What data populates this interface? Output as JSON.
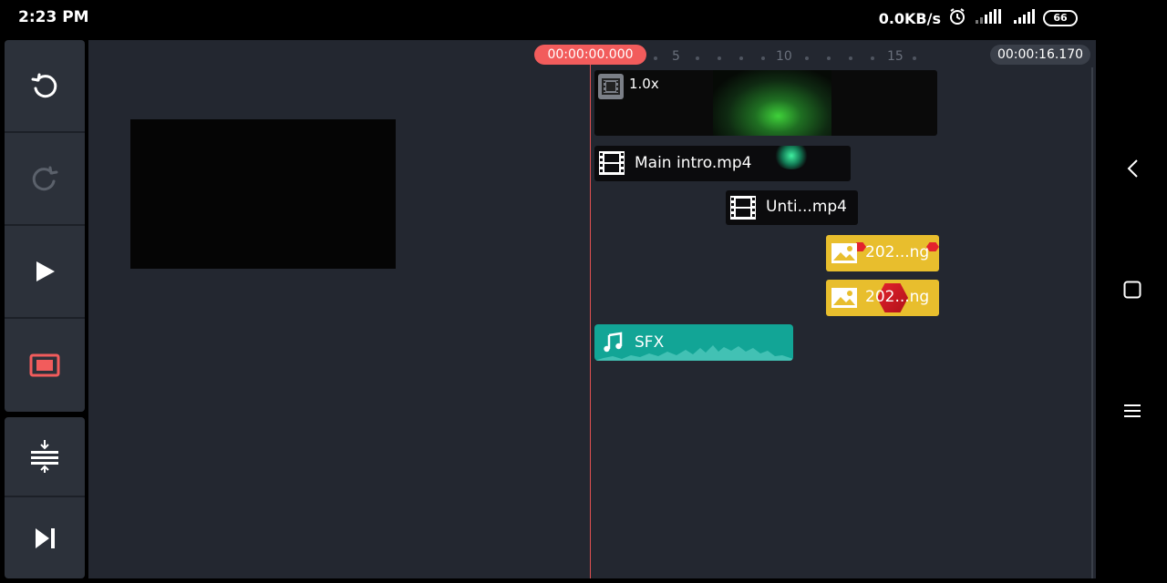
{
  "status_bar": {
    "time": "2:23 PM",
    "network_speed": "0.0KB/s",
    "battery_level": "66"
  },
  "toolbar": {
    "buttons": [
      {
        "name": "undo",
        "icon": "undo-icon",
        "enabled": true
      },
      {
        "name": "redo",
        "icon": "redo-icon",
        "enabled": false
      },
      {
        "name": "play",
        "icon": "play-icon",
        "enabled": true
      },
      {
        "name": "fullscreen-preview",
        "icon": "preview-screen-icon",
        "enabled": true,
        "color": "#f25c5c"
      },
      {
        "name": "track-height",
        "icon": "compress-tracks-icon",
        "enabled": true
      },
      {
        "name": "skip-to-end",
        "icon": "skip-end-icon",
        "enabled": true
      }
    ]
  },
  "timeline": {
    "current_time": "00:00:00.000",
    "total_duration": "00:00:16.170",
    "ruler_ticks": [
      "5",
      "10",
      "15"
    ],
    "clips": {
      "main_video": {
        "speed": "1.0x",
        "type": "video"
      },
      "layer_video_1": {
        "name": "Main intro.mp4",
        "type": "video"
      },
      "layer_video_2": {
        "name": "Unti...mp4",
        "type": "video"
      },
      "layer_image_1": {
        "name": "202...ng",
        "type": "image",
        "color": "#e8be2d"
      },
      "layer_image_2": {
        "name": "202...ng",
        "type": "image",
        "color": "#e8be2d"
      },
      "audio": {
        "name": "SFX",
        "type": "audio",
        "color": "#12a596"
      }
    }
  },
  "colors": {
    "accent_red": "#f25c5c",
    "workspace_bg": "#232730",
    "toolbar_bg": "#2c313a"
  }
}
